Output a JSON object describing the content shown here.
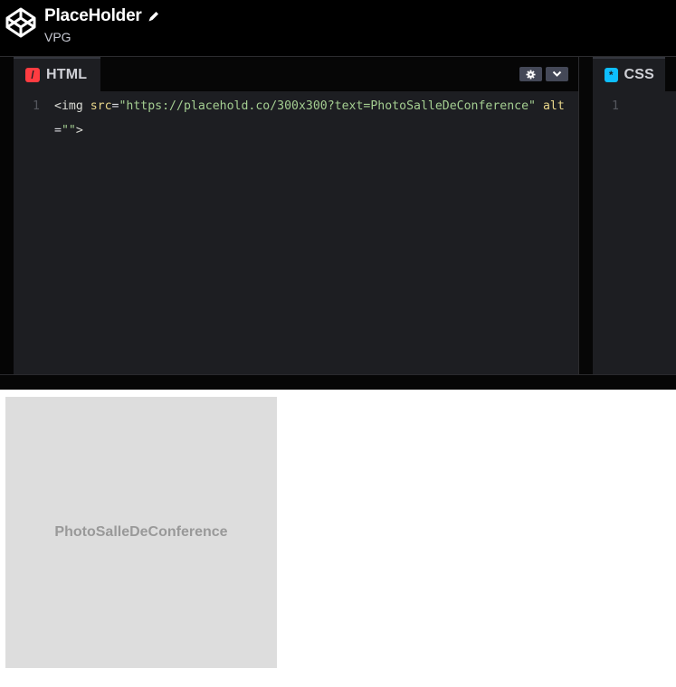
{
  "header": {
    "title": "PlaceHolder",
    "owner": "VPG"
  },
  "html_pane": {
    "tab_label": "HTML",
    "badge_glyph": "/",
    "badge_color": "#ff3c41",
    "line_number": "1",
    "code_tokens": {
      "open": "<img ",
      "attr1": "src",
      "eq1": "=",
      "str1": "\"https://placehold.co/300x300?text=PhotoSalleDeConference\"",
      "space": " ",
      "attr2": "alt",
      "eq2": "=",
      "str2": "\"\"",
      "close": ">"
    }
  },
  "css_pane": {
    "tab_label": "CSS",
    "badge_glyph": "*",
    "badge_color": "#0ebeff",
    "line_number": "1"
  },
  "preview": {
    "image_text": "PhotoSalleDeConference"
  },
  "icons": {
    "logo": "codepen-logo-icon",
    "edit": "pencil-icon",
    "settings": "gear-icon",
    "collapse": "chevron-down-icon"
  },
  "colors": {
    "header_bg": "#000000",
    "editor_bg": "#1d1e22",
    "placeholder_bg": "#dddddd",
    "placeholder_text": "#999999"
  }
}
